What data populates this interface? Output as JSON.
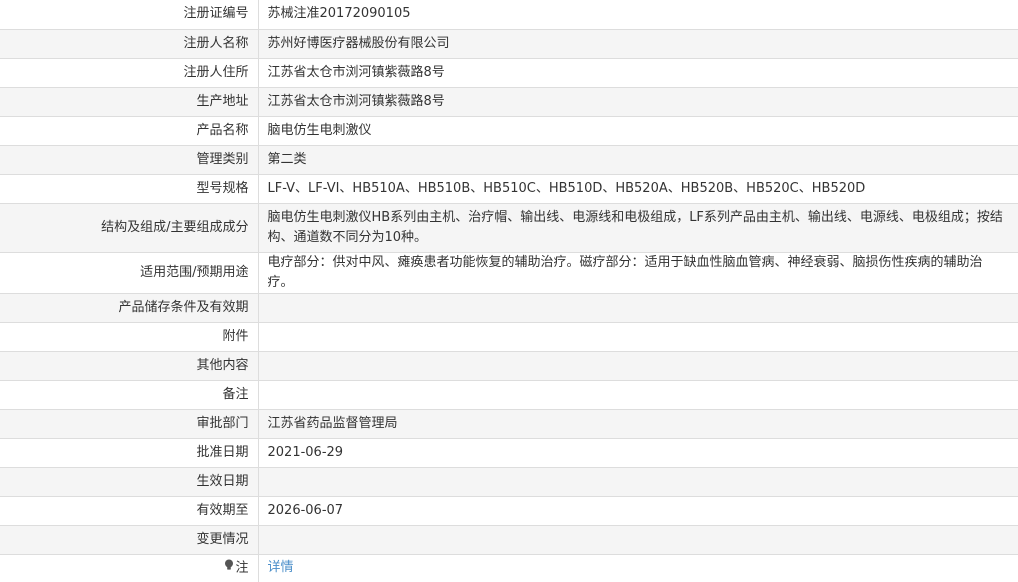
{
  "rows": [
    {
      "label": "注册证编号",
      "value": "苏械注准20172090105"
    },
    {
      "label": "注册人名称",
      "value": "苏州好博医疗器械股份有限公司"
    },
    {
      "label": "注册人住所",
      "value": "江苏省太仓市浏河镇紫薇路8号"
    },
    {
      "label": "生产地址",
      "value": "江苏省太仓市浏河镇紫薇路8号"
    },
    {
      "label": "产品名称",
      "value": "脑电仿生电刺激仪"
    },
    {
      "label": "管理类别",
      "value": "第二类"
    },
    {
      "label": "型号规格",
      "value": "LF-V、LF-VI、HB510A、HB510B、HB510C、HB510D、HB520A、HB520B、HB520C、HB520D"
    },
    {
      "label": "结构及组成/主要组成成分",
      "value": "脑电仿生电刺激仪HB系列由主机、治疗帽、输出线、电源线和电极组成，LF系列产品由主机、输出线、电源线、电极组成；按结构、通道数不同分为10种。"
    },
    {
      "label": "适用范围/预期用途",
      "value": "电疗部分：供对中风、瘫痪患者功能恢复的辅助治疗。磁疗部分：适用于缺血性脑血管病、神经衰弱、脑损伤性疾病的辅助治疗。"
    },
    {
      "label": "产品储存条件及有效期",
      "value": ""
    },
    {
      "label": "附件",
      "value": ""
    },
    {
      "label": "其他内容",
      "value": ""
    },
    {
      "label": "备注",
      "value": ""
    },
    {
      "label": "审批部门",
      "value": "江苏省药品监督管理局"
    },
    {
      "label": "批准日期",
      "value": "2021-06-29"
    },
    {
      "label": "生效日期",
      "value": ""
    },
    {
      "label": "有效期至",
      "value": "2026-06-07"
    },
    {
      "label": "变更情况",
      "value": ""
    }
  ],
  "note": {
    "label": "注",
    "link_text": "详情",
    "icon": "lightbulb-icon"
  }
}
